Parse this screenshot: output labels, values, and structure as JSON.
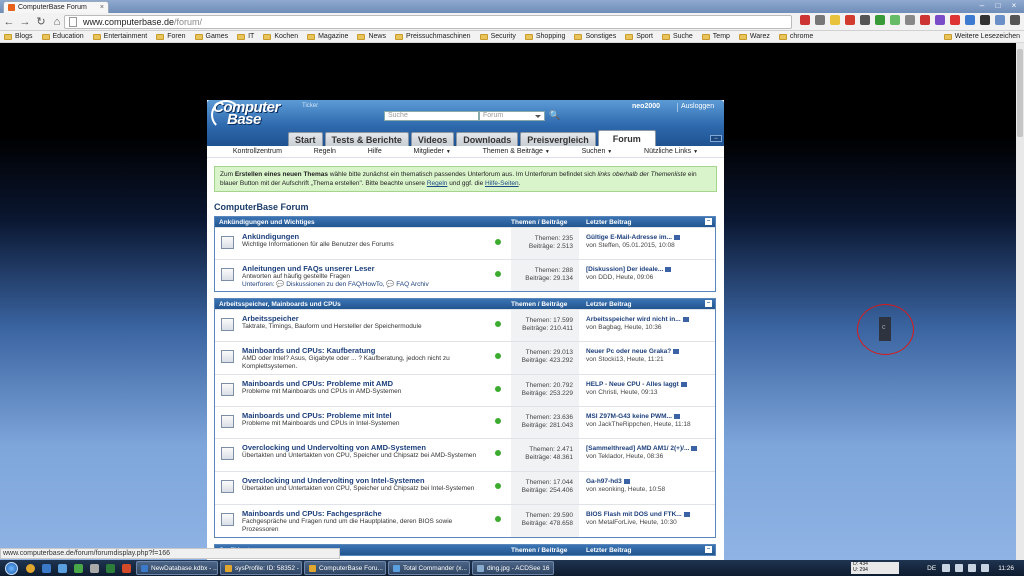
{
  "browser": {
    "tab_title": "ComputerBase Forum",
    "tab_close": "×",
    "url_domain": "www.computerbase.de",
    "url_path": "/forum/",
    "bookmarks": [
      "Blogs",
      "Education",
      "Entertainment",
      "Foren",
      "Games",
      "IT",
      "Kochen",
      "Magazine",
      "News",
      "Preissuchmaschinen",
      "Security",
      "Shopping",
      "Sonstiges",
      "Sport",
      "Suche",
      "Temp",
      "Warez",
      "chrome"
    ],
    "other_bookmarks": "Weitere Lesezeichen",
    "status_url": "www.computerbase.de/forum/forumdisplay.php?f=166"
  },
  "site": {
    "logo_line1": "Computer",
    "logo_line2": "Base",
    "ticker": "Ticker",
    "search_placeholder": "Suche",
    "search_scope": "Forum",
    "user": "neo2000",
    "logout": "Ausloggen",
    "tabs": [
      "Start",
      "Tests & Berichte",
      "Videos",
      "Downloads",
      "Preisvergleich",
      "Forum"
    ],
    "subnav": [
      {
        "label": "Kontrollzentrum",
        "caret": false
      },
      {
        "label": "Regeln",
        "caret": false
      },
      {
        "label": "Hilfe",
        "caret": false
      },
      {
        "label": "Mitglieder",
        "caret": true
      },
      {
        "label": "Themen & Beiträge",
        "caret": true
      },
      {
        "label": "Suchen",
        "caret": true
      },
      {
        "label": "Nützliche Links",
        "caret": true
      }
    ]
  },
  "notice": {
    "p1": "Zum ",
    "bold": "Erstellen eines neuen Themas",
    "p2": " wähle bitte zunächst ein thematisch passendes Unterforum aus. Im Unterforum befindet sich ",
    "ital1": "links oberhalb der Themenliste",
    "p3": " ein blauer Button mit der Aufschrift „Thema erstellen\". Bitte beachte unsere ",
    "link1": "Regeln",
    "p4": " und ggf. die ",
    "link2": "Hilfe-Seiten",
    "p5": "."
  },
  "forum_title": "ComputerBase Forum",
  "columns": {
    "threads_posts": "Themen / Beiträge",
    "last_post": "Letzter Beitrag",
    "collapse": "–"
  },
  "categories": [
    {
      "title": "Ankündigungen und Wichtiges",
      "rows": [
        {
          "title": "Ankündigungen",
          "desc": "Wichtige Informationen für alle Benutzer des Forums",
          "sub": "",
          "threads": "Themen: 235",
          "posts": "Beiträge: 2.513",
          "last_title": "Gültige E-Mail-Adresse im...",
          "last_by": "von Steffen, 05.01.2015, 10:08"
        },
        {
          "title": "Anleitungen und FAQs unserer Leser",
          "desc": "Antworten auf häufig gestellte Fragen",
          "sub": "Unterforen: 💬 Diskussionen zu den FAQ/HowTo, 💬 FAQ Archiv",
          "threads": "Themen: 288",
          "posts": "Beiträge: 29.134",
          "last_title": "[Diskussion] Der ideale...",
          "last_by": "von DDD, Heute, 09:06"
        }
      ]
    },
    {
      "title": "Arbeitsspeicher, Mainboards und CPUs",
      "rows": [
        {
          "title": "Arbeitsspeicher",
          "desc": "Taktrate, Timings, Bauform und Hersteller der Speichermodule",
          "sub": "",
          "threads": "Themen: 17.599",
          "posts": "Beiträge: 210.411",
          "last_title": "Arbeitsspeicher wird nicht in...",
          "last_by": "von Bagbag, Heute, 10:36"
        },
        {
          "title": "Mainboards und CPUs: Kaufberatung",
          "desc": "AMD oder Intel? Asus, Gigabyte oder ... ? Kaufberatung, jedoch nicht zu Komplettsystemen.",
          "sub": "",
          "threads": "Themen: 29.013",
          "posts": "Beiträge: 423.292",
          "last_title": "Neuer Pc oder neue Graka?",
          "last_by": "von Stocki13, Heute, 11:21"
        },
        {
          "title": "Mainboards und CPUs: Probleme mit AMD",
          "desc": "Probleme mit Mainboards und CPUs in AMD-Systemen",
          "sub": "",
          "threads": "Themen: 20.792",
          "posts": "Beiträge: 253.229",
          "last_title": "HELP - Neue CPU - Alles laggt",
          "last_by": "von Christi, Heute, 09:13"
        },
        {
          "title": "Mainboards und CPUs: Probleme mit Intel",
          "desc": "Probleme mit Mainboards und CPUs in Intel-Systemen",
          "sub": "",
          "threads": "Themen: 23.636",
          "posts": "Beiträge: 281.043",
          "last_title": "MSI Z97M-G43 keine PWM...",
          "last_by": "von JackTheRippchen, Heute, 11:18"
        },
        {
          "title": "Overclocking und Undervolting von AMD-Systemen",
          "desc": "Übertakten und Untertakten von CPU, Speicher und Chipsatz bei AMD-Systemen",
          "sub": "",
          "threads": "Themen: 2.471",
          "posts": "Beiträge: 48.361",
          "last_title": "[Sammelthread] AMD AM1/ 2(+)/...",
          "last_by": "von Teklador, Heute, 08:36"
        },
        {
          "title": "Overclocking und Undervolting von Intel-Systemen",
          "desc": "Übertakten und Untertakten von CPU, Speicher und Chipsatz bei Intel-Systemen",
          "sub": "",
          "threads": "Themen: 17.044",
          "posts": "Beiträge: 254.406",
          "last_title": "Ga-h97-hd3",
          "last_by": "von xeonking, Heute, 10:58"
        },
        {
          "title": "Mainboards und CPUs: Fachgespräche",
          "desc": "Fachgespräche und Fragen rund um die Hauptplatine, deren BIOS sowie Prozessoren",
          "sub": "",
          "threads": "Themen: 29.590",
          "posts": "Beiträge: 478.658",
          "last_title": "BIOS Flash mit DOS und FTK...",
          "last_by": "von MetalForLive, Heute, 10:30"
        }
      ]
    },
    {
      "title": "Grafikkarten",
      "rows": []
    }
  ],
  "taskbar": {
    "tasks": [
      {
        "label": "NewDatabase.kdbx - ...",
        "color": "#3a7ac8"
      },
      {
        "label": "sysProfile: ID: 58352 - ...",
        "color": "#e0a62e"
      },
      {
        "label": "ComputerBase Foru...",
        "color": "#e0a62e"
      },
      {
        "label": "Total Commander (x...",
        "color": "#5aa0e0"
      },
      {
        "label": "ding.jpg - ACDSee 16",
        "color": "#8ac"
      }
    ],
    "meter_line1": "D: 434",
    "meter_line2": "U: 294",
    "lang": "DE",
    "clock": "11:26"
  }
}
